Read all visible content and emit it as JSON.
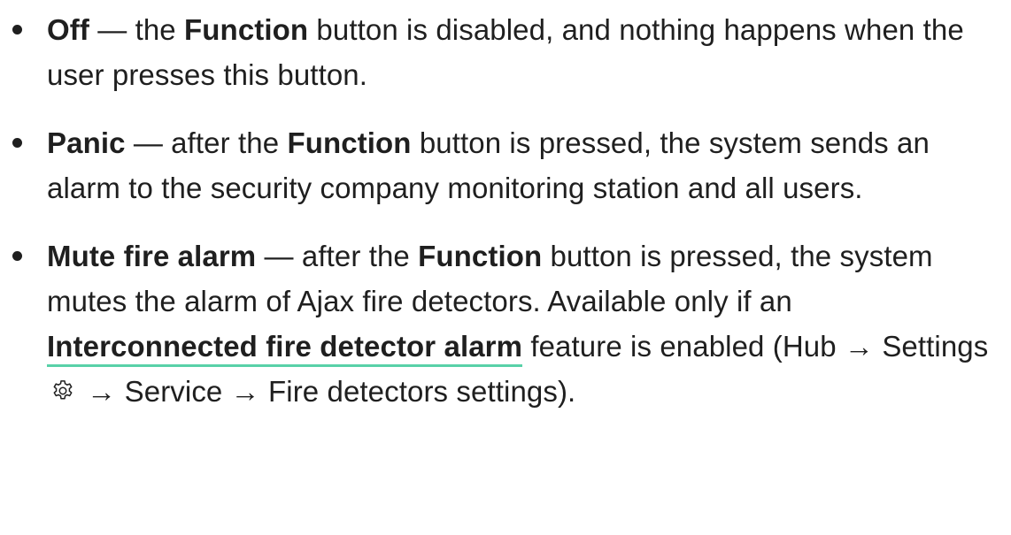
{
  "items": [
    {
      "term": "Off",
      "dash": " — the ",
      "func": "Function",
      "rest": " button is disabled, and nothing happens when the user presses this button."
    },
    {
      "term": "Panic",
      "dash": " — after the ",
      "func": "Function",
      "rest": " button is pressed, the system sends an alarm to the security company monitoring station and all users."
    },
    {
      "term": "Mute fire alarm",
      "dash": " — after the ",
      "func": "Function",
      "mid": " button is pressed, the system mutes the alarm of Ajax fire detectors. Available only if an ",
      "link": "Interconnected fire detector alarm",
      "after_link": " feature is enabled (Hub → Settings ",
      "tail": " → Service → Fire detectors settings)."
    }
  ],
  "colors": {
    "text": "#1f1f1f",
    "link_underline": "#58d1a8"
  },
  "icons": {
    "settings": "gear-icon"
  }
}
